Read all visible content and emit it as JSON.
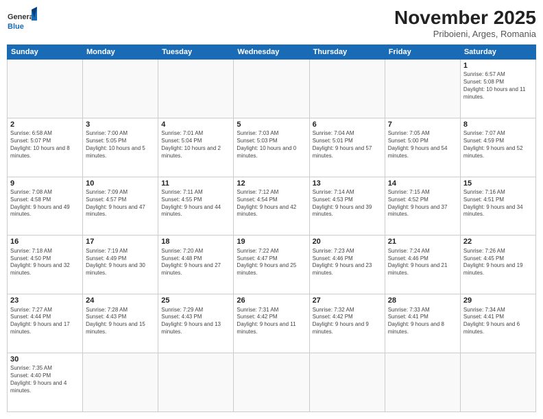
{
  "header": {
    "logo_general": "General",
    "logo_blue": "Blue",
    "month_title": "November 2025",
    "location": "Priboieni, Arges, Romania"
  },
  "weekdays": [
    "Sunday",
    "Monday",
    "Tuesday",
    "Wednesday",
    "Thursday",
    "Friday",
    "Saturday"
  ],
  "weeks": [
    [
      {
        "day": "",
        "info": ""
      },
      {
        "day": "",
        "info": ""
      },
      {
        "day": "",
        "info": ""
      },
      {
        "day": "",
        "info": ""
      },
      {
        "day": "",
        "info": ""
      },
      {
        "day": "",
        "info": ""
      },
      {
        "day": "1",
        "info": "Sunrise: 6:57 AM\nSunset: 5:08 PM\nDaylight: 10 hours and 11 minutes."
      }
    ],
    [
      {
        "day": "2",
        "info": "Sunrise: 6:58 AM\nSunset: 5:07 PM\nDaylight: 10 hours and 8 minutes."
      },
      {
        "day": "3",
        "info": "Sunrise: 7:00 AM\nSunset: 5:05 PM\nDaylight: 10 hours and 5 minutes."
      },
      {
        "day": "4",
        "info": "Sunrise: 7:01 AM\nSunset: 5:04 PM\nDaylight: 10 hours and 2 minutes."
      },
      {
        "day": "5",
        "info": "Sunrise: 7:03 AM\nSunset: 5:03 PM\nDaylight: 10 hours and 0 minutes."
      },
      {
        "day": "6",
        "info": "Sunrise: 7:04 AM\nSunset: 5:01 PM\nDaylight: 9 hours and 57 minutes."
      },
      {
        "day": "7",
        "info": "Sunrise: 7:05 AM\nSunset: 5:00 PM\nDaylight: 9 hours and 54 minutes."
      },
      {
        "day": "8",
        "info": "Sunrise: 7:07 AM\nSunset: 4:59 PM\nDaylight: 9 hours and 52 minutes."
      }
    ],
    [
      {
        "day": "9",
        "info": "Sunrise: 7:08 AM\nSunset: 4:58 PM\nDaylight: 9 hours and 49 minutes."
      },
      {
        "day": "10",
        "info": "Sunrise: 7:09 AM\nSunset: 4:57 PM\nDaylight: 9 hours and 47 minutes."
      },
      {
        "day": "11",
        "info": "Sunrise: 7:11 AM\nSunset: 4:55 PM\nDaylight: 9 hours and 44 minutes."
      },
      {
        "day": "12",
        "info": "Sunrise: 7:12 AM\nSunset: 4:54 PM\nDaylight: 9 hours and 42 minutes."
      },
      {
        "day": "13",
        "info": "Sunrise: 7:14 AM\nSunset: 4:53 PM\nDaylight: 9 hours and 39 minutes."
      },
      {
        "day": "14",
        "info": "Sunrise: 7:15 AM\nSunset: 4:52 PM\nDaylight: 9 hours and 37 minutes."
      },
      {
        "day": "15",
        "info": "Sunrise: 7:16 AM\nSunset: 4:51 PM\nDaylight: 9 hours and 34 minutes."
      }
    ],
    [
      {
        "day": "16",
        "info": "Sunrise: 7:18 AM\nSunset: 4:50 PM\nDaylight: 9 hours and 32 minutes."
      },
      {
        "day": "17",
        "info": "Sunrise: 7:19 AM\nSunset: 4:49 PM\nDaylight: 9 hours and 30 minutes."
      },
      {
        "day": "18",
        "info": "Sunrise: 7:20 AM\nSunset: 4:48 PM\nDaylight: 9 hours and 27 minutes."
      },
      {
        "day": "19",
        "info": "Sunrise: 7:22 AM\nSunset: 4:47 PM\nDaylight: 9 hours and 25 minutes."
      },
      {
        "day": "20",
        "info": "Sunrise: 7:23 AM\nSunset: 4:46 PM\nDaylight: 9 hours and 23 minutes."
      },
      {
        "day": "21",
        "info": "Sunrise: 7:24 AM\nSunset: 4:46 PM\nDaylight: 9 hours and 21 minutes."
      },
      {
        "day": "22",
        "info": "Sunrise: 7:26 AM\nSunset: 4:45 PM\nDaylight: 9 hours and 19 minutes."
      }
    ],
    [
      {
        "day": "23",
        "info": "Sunrise: 7:27 AM\nSunset: 4:44 PM\nDaylight: 9 hours and 17 minutes."
      },
      {
        "day": "24",
        "info": "Sunrise: 7:28 AM\nSunset: 4:43 PM\nDaylight: 9 hours and 15 minutes."
      },
      {
        "day": "25",
        "info": "Sunrise: 7:29 AM\nSunset: 4:43 PM\nDaylight: 9 hours and 13 minutes."
      },
      {
        "day": "26",
        "info": "Sunrise: 7:31 AM\nSunset: 4:42 PM\nDaylight: 9 hours and 11 minutes."
      },
      {
        "day": "27",
        "info": "Sunrise: 7:32 AM\nSunset: 4:42 PM\nDaylight: 9 hours and 9 minutes."
      },
      {
        "day": "28",
        "info": "Sunrise: 7:33 AM\nSunset: 4:41 PM\nDaylight: 9 hours and 8 minutes."
      },
      {
        "day": "29",
        "info": "Sunrise: 7:34 AM\nSunset: 4:41 PM\nDaylight: 9 hours and 6 minutes."
      }
    ],
    [
      {
        "day": "30",
        "info": "Sunrise: 7:35 AM\nSunset: 4:40 PM\nDaylight: 9 hours and 4 minutes."
      },
      {
        "day": "",
        "info": ""
      },
      {
        "day": "",
        "info": ""
      },
      {
        "day": "",
        "info": ""
      },
      {
        "day": "",
        "info": ""
      },
      {
        "day": "",
        "info": ""
      },
      {
        "day": "",
        "info": ""
      }
    ]
  ]
}
